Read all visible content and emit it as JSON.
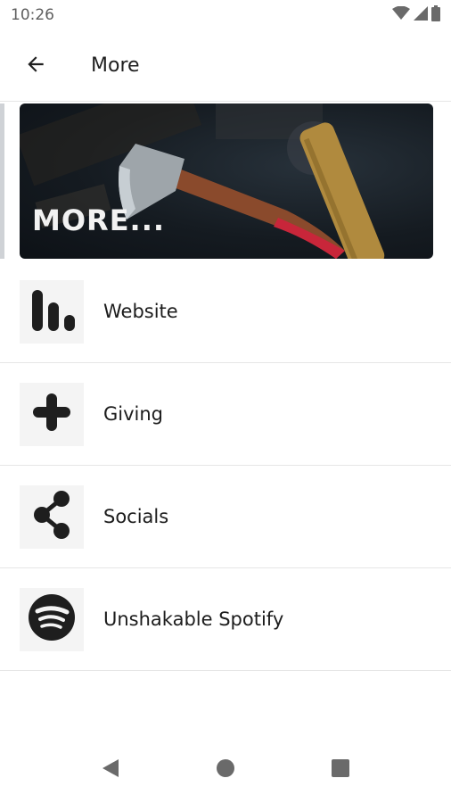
{
  "status_bar": {
    "time": "10:26",
    "icons": [
      "wifi-icon",
      "cellular-signal-icon",
      "battery-icon"
    ]
  },
  "app_bar": {
    "back_icon": "arrow-back-icon",
    "title": "More"
  },
  "banner": {
    "text": "MORE...",
    "image": "axe-on-workbench-photo"
  },
  "menu": {
    "items": [
      {
        "label": "Website",
        "icon": "bar-stats-icon"
      },
      {
        "label": "Giving",
        "icon": "plus-icon"
      },
      {
        "label": "Socials",
        "icon": "share-icon"
      },
      {
        "label": "Unshakable Spotify",
        "icon": "spotify-icon"
      }
    ]
  },
  "nav_bar": {
    "icons": [
      "back-triangle-icon",
      "home-circle-icon",
      "recents-square-icon"
    ]
  },
  "colors": {
    "icon_dark": "#1e1e1e",
    "icon_box_bg": "#f4f4f4",
    "divider": "#e6e6e6",
    "nav_icon": "#6a6a6a"
  }
}
